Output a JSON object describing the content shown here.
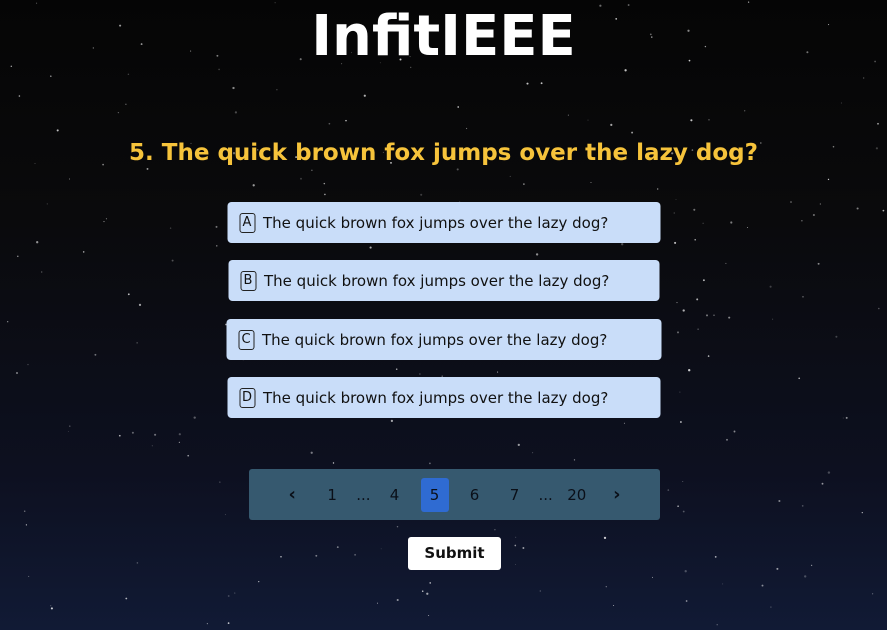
{
  "app": {
    "title": "InfitIEEE"
  },
  "question": {
    "text": "5. The quick brown fox jumps over the lazy dog?"
  },
  "options": [
    {
      "letter": "A",
      "text": "The quick brown fox jumps over the lazy dog?"
    },
    {
      "letter": "B",
      "text": "The quick brown fox jumps over the lazy dog?"
    },
    {
      "letter": "C",
      "text": "The quick brown fox jumps over the lazy dog?"
    },
    {
      "letter": "D",
      "text": "The quick brown fox jumps over the lazy dog?"
    }
  ],
  "pagination": {
    "prev": "‹",
    "first": "1",
    "ellipsis_left": "...",
    "p4": "4",
    "p5": "5",
    "p6": "6",
    "p7": "7",
    "ellipsis_right": "...",
    "last": "20",
    "next": "›",
    "current": "5"
  },
  "submit": {
    "label": "Submit"
  },
  "colors": {
    "title": "#ffffff",
    "question": "#f6c33b",
    "option_bg": "#c9ddf9",
    "pagination_bg": "#36596f",
    "active_page": "#2f6bd2"
  },
  "icons": {
    "prev": "chevron-left-icon",
    "next": "chevron-right-icon"
  }
}
